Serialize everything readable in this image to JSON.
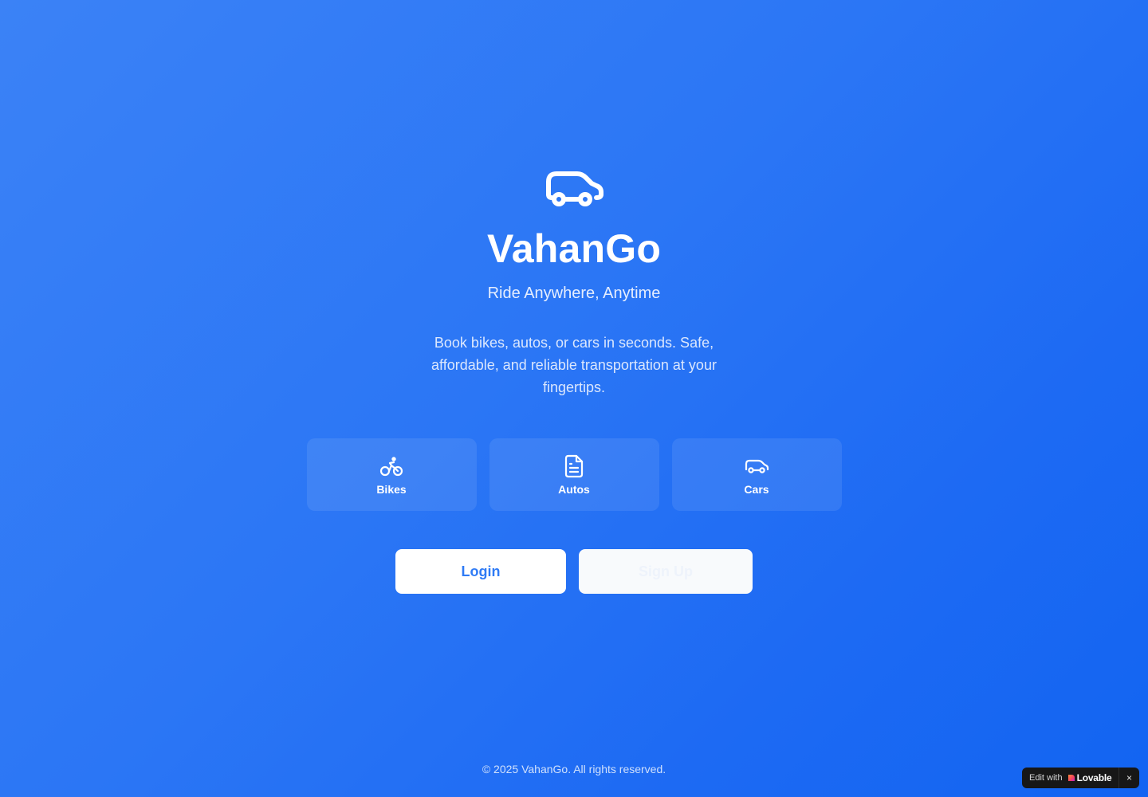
{
  "app": {
    "title": "VahanGo",
    "tagline": "Ride Anywhere, Anytime",
    "description": "Book bikes, autos, or cars in seconds. Safe, affordable, and reliable transportation at your fingertips.",
    "hero_icon": "car-icon"
  },
  "features": [
    {
      "label": "Bikes",
      "icon": "bike-icon"
    },
    {
      "label": "Autos",
      "icon": "file-text-icon"
    },
    {
      "label": "Cars",
      "icon": "car-icon"
    }
  ],
  "actions": {
    "login_label": "Login",
    "signup_label": "Sign Up"
  },
  "footer": {
    "copyright": "© 2025 VahanGo. All rights reserved."
  },
  "badge": {
    "prefix": "Edit with",
    "brand": "Lovable",
    "close": "×"
  },
  "colors": {
    "background_start": "#3b82f6",
    "background_end": "#1264f2",
    "primary_text": "#ffffff",
    "login_text": "#2f7bf5",
    "badge_background": "#171717"
  }
}
